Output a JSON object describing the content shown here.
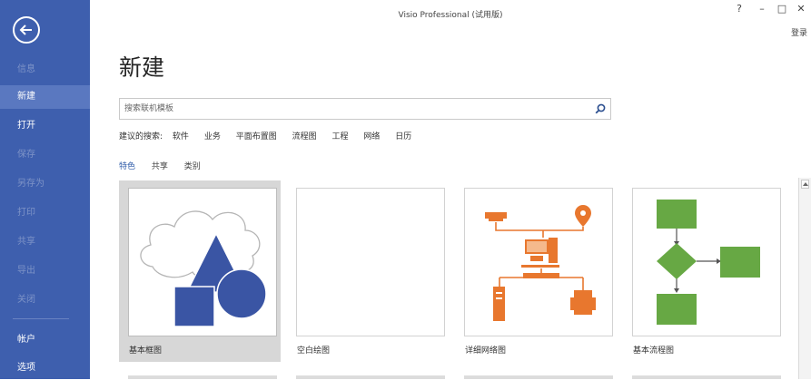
{
  "window": {
    "title": "Visio Professional (试用版)",
    "help": "?",
    "minimize": "–",
    "maximize": "□",
    "close": "✕",
    "login": "登录"
  },
  "sidebar": {
    "items": [
      {
        "label": "信息",
        "state": "disabled"
      },
      {
        "label": "新建",
        "state": "active"
      },
      {
        "label": "打开",
        "state": "normal"
      },
      {
        "label": "保存",
        "state": "disabled"
      },
      {
        "label": "另存为",
        "state": "disabled"
      },
      {
        "label": "打印",
        "state": "disabled"
      },
      {
        "label": "共享",
        "state": "disabled"
      },
      {
        "label": "导出",
        "state": "disabled"
      },
      {
        "label": "关闭",
        "state": "disabled"
      },
      {
        "label": "帐户",
        "state": "normal"
      },
      {
        "label": "选项",
        "state": "normal"
      }
    ]
  },
  "main": {
    "heading": "新建",
    "search": {
      "placeholder": "搜索联机模板"
    },
    "suggested": {
      "label": "建议的搜索:",
      "items": [
        "软件",
        "业务",
        "平面布置图",
        "流程图",
        "工程",
        "网络",
        "日历"
      ]
    },
    "tabs": [
      {
        "label": "特色",
        "active": true
      },
      {
        "label": "共享",
        "active": false
      },
      {
        "label": "类别",
        "active": false
      }
    ],
    "templates": [
      {
        "label": "基本框图",
        "selected": true
      },
      {
        "label": "空白绘图",
        "selected": false
      },
      {
        "label": "详细网络图",
        "selected": false
      },
      {
        "label": "基本流程图",
        "selected": false
      }
    ]
  },
  "colors": {
    "sidebar": "#3e5fae",
    "sidebar_active": "#5a78c0",
    "shape_blue": "#3a55a4",
    "network_orange": "#e8772e",
    "flow_green": "#67a844"
  },
  "icons": [
    "back-arrow-icon",
    "search-icon",
    "scroll-up-arrow-icon"
  ]
}
